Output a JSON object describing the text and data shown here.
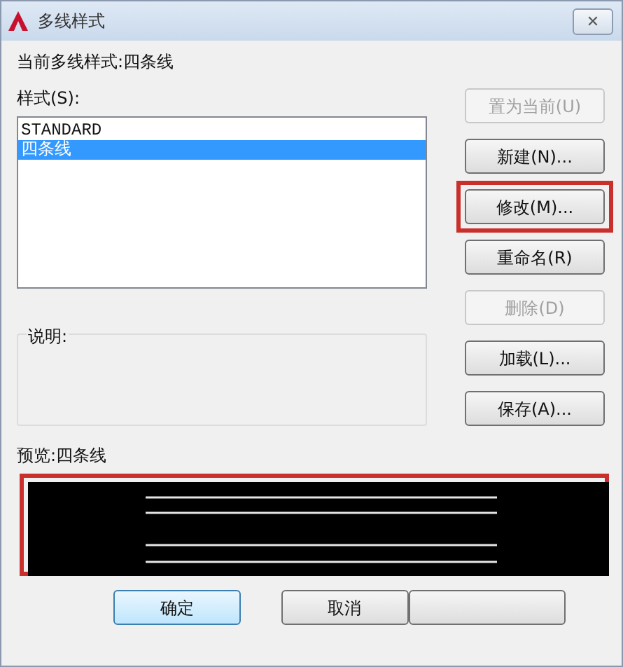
{
  "window": {
    "title": "多线样式",
    "close": "✕"
  },
  "current_style": "当前多线样式:四条线",
  "styles": {
    "label": "样式(S):",
    "items": [
      {
        "name": "STANDARD",
        "selected": false
      },
      {
        "name": "四条线",
        "selected": true
      }
    ]
  },
  "side_buttons": [
    {
      "label": "置为当前(U)",
      "disabled": true,
      "highlighted": false
    },
    {
      "label": "新建(N)...",
      "disabled": false,
      "highlighted": false
    },
    {
      "label": "修改(M)...",
      "disabled": false,
      "highlighted": true
    },
    {
      "label": "重命名(R)",
      "disabled": false,
      "highlighted": false
    },
    {
      "label": "删除(D)",
      "disabled": true,
      "highlighted": false
    },
    {
      "label": "加载(L)...",
      "disabled": false,
      "highlighted": false
    },
    {
      "label": "保存(A)...",
      "disabled": false,
      "highlighted": false
    }
  ],
  "description": {
    "label": "说明:"
  },
  "preview": {
    "label": "预览:四条线",
    "highlighted": true
  },
  "bottom_buttons": [
    {
      "label": "确定",
      "default": true
    },
    {
      "label": "取消",
      "default": false
    },
    {
      "default": false
    }
  ]
}
